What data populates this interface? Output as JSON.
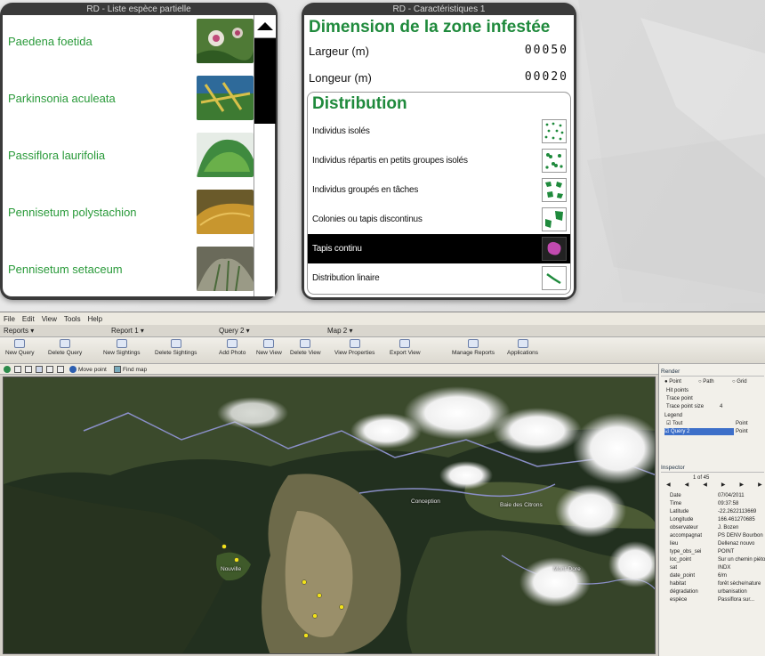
{
  "species_list": {
    "title": "RD - Liste espèce partielle",
    "items": [
      {
        "name": "Paedena foetida",
        "thumb_color": "#6a9a4a",
        "accent": "#e06aa0"
      },
      {
        "name": "Parkinsonia aculeata",
        "thumb_color": "#3c7d3a",
        "accent": "#d8c04a"
      },
      {
        "name": "Passiflora laurifolia",
        "thumb_color": "#3f8a3f",
        "accent": "#7cc06a"
      },
      {
        "name": "Pennisetum polystachion",
        "thumb_color": "#b58a3a",
        "accent": "#8a9a3a"
      },
      {
        "name": "Pennisetum setaceum",
        "thumb_color": "#8a8a7a",
        "accent": "#5a7a4a"
      }
    ]
  },
  "characteristics": {
    "title": "RD - Caractéristiques 1",
    "dimension_title": "Dimension de la zone infestée",
    "width_label": "Largeur (m)",
    "width_value": "00050",
    "length_label": "Longeur (m)",
    "length_value": "00020",
    "distribution_title": "Distribution",
    "distribution_items": [
      {
        "label": "Individus isolés",
        "icon": "scattered-dots-icon",
        "selected": false
      },
      {
        "label": "Individus répartis en petits groupes isolés",
        "icon": "small-groups-icon",
        "selected": false
      },
      {
        "label": "Individus groupés en tâches",
        "icon": "grouped-patches-icon",
        "selected": false
      },
      {
        "label": "Colonies ou tapis discontinus",
        "icon": "discontinuous-colonies-icon",
        "selected": false
      },
      {
        "label": "Tapis continu",
        "icon": "continuous-carpet-icon",
        "selected": true
      },
      {
        "label": "Distribution linaire",
        "icon": "linear-distribution-icon",
        "selected": false
      }
    ]
  },
  "app": {
    "menu": [
      "File",
      "Edit",
      "View",
      "Tools",
      "Help"
    ],
    "tabs": [
      {
        "label": "Reports ▾"
      },
      {
        "label": "Report 1 ▾"
      },
      {
        "label": "Query 2 ▾"
      },
      {
        "label": "Map 2 ▾"
      }
    ],
    "toolbar": [
      "New Query",
      "Delete Query",
      "New Sightings",
      "Delete Sightings",
      "Add Photo",
      "New View",
      "Delete View",
      "View Properties",
      "Export View",
      "Manage Reports",
      "Applications"
    ],
    "map_tools": [
      {
        "label": "",
        "icon": "globe-icon"
      },
      {
        "label": "",
        "icon": "zoom-in-icon"
      },
      {
        "label": "",
        "icon": "zoom-out-icon"
      },
      {
        "label": "",
        "icon": "select-icon"
      },
      {
        "label": "",
        "icon": "pan-icon"
      },
      {
        "label": "",
        "icon": "measure-icon"
      },
      {
        "label": "Move point",
        "icon": "move-point-icon"
      },
      {
        "label": "Find map",
        "icon": "find-map-icon"
      }
    ],
    "map_labels": [
      "Nouville",
      "Conception",
      "Mont-Dore",
      "Baie des Citrons"
    ],
    "side": {
      "render_head": "Render",
      "render_options": [
        "Point",
        "Path",
        "Grid"
      ],
      "render_rows": [
        "Hit points",
        "Trace point",
        "Trace point size",
        "Legend"
      ],
      "trace_point_size": "4",
      "legend_rows": [
        "Tout",
        "Query 2"
      ],
      "legend_types": [
        "Point",
        "Point"
      ],
      "inspector_head": "Inspector",
      "inspector_nav": "1 of 45",
      "inspector": [
        {
          "k": "Date",
          "v": "07/04/2011"
        },
        {
          "k": "Time",
          "v": "09:37:58"
        },
        {
          "k": "Latitude",
          "v": "-22.2622113669"
        },
        {
          "k": "Longitude",
          "v": "166.461270685"
        },
        {
          "k": "observateur",
          "v": "J. Bozen"
        },
        {
          "k": "accompagnat",
          "v": "PS DENV Bourbon"
        },
        {
          "k": "lieu",
          "v": "Dellenaz nouvo"
        },
        {
          "k": "type_obs_sei",
          "v": "POINT"
        },
        {
          "k": "loc_point",
          "v": "Sur un chemin piéton"
        },
        {
          "k": "sat",
          "v": "INDX"
        },
        {
          "k": "date_point",
          "v": "6/m"
        },
        {
          "k": "habitat",
          "v": "forêt sèche/nature"
        },
        {
          "k": "dégradation",
          "v": "urbanisation"
        },
        {
          "k": "espèce",
          "v": "Passiflora sur..."
        }
      ]
    }
  }
}
